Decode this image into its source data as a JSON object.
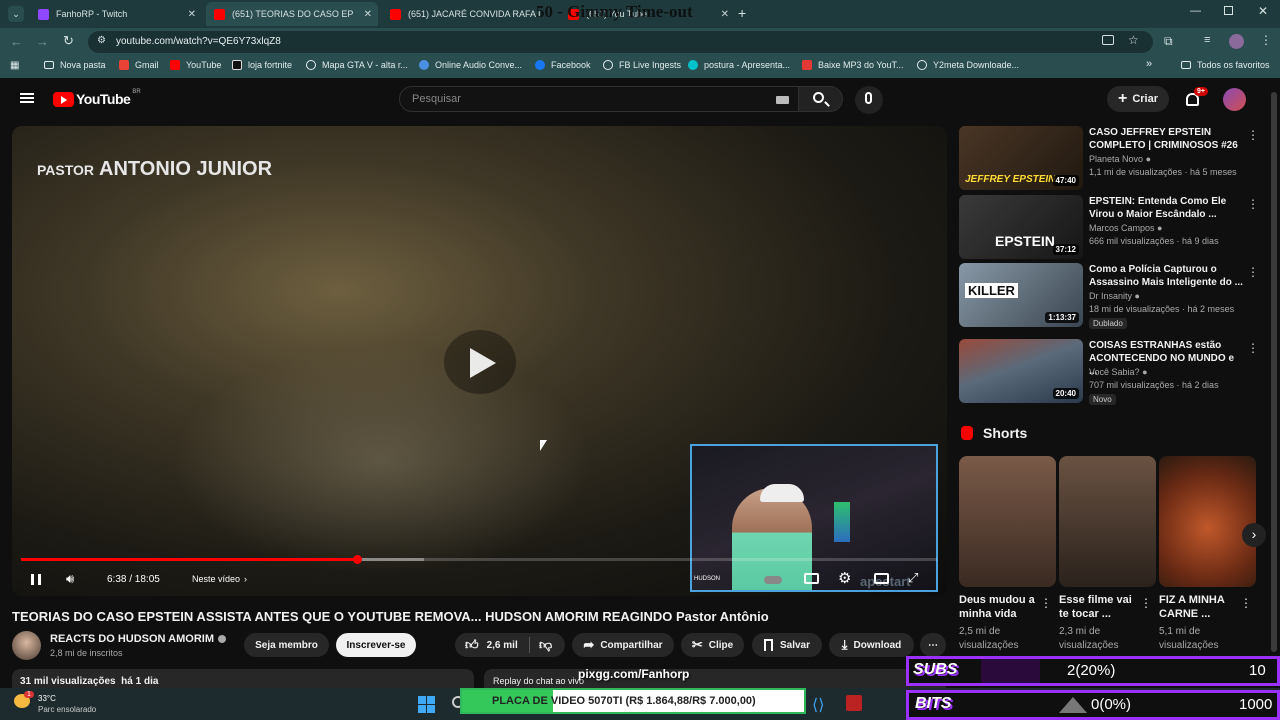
{
  "browser": {
    "tabs": [
      {
        "title": "FanhoRP - Twitch",
        "favicon_color": "#9146ff"
      },
      {
        "title": "(651) TEORIAS DO CASO EP",
        "favicon_color": "#ff0000"
      },
      {
        "title": "(651) JACARÉ CONVIDA RAFA I",
        "favicon_color": "#ff0000"
      },
      {
        "title": "(651) You Tube",
        "favicon_color": "#ff0000"
      }
    ],
    "overlay_text": "50 - Gimmy Time-out",
    "url": "youtube.com/watch?v=QE6Y73xlqZ8",
    "bookmarks": [
      "Nova pasta",
      "Gmail",
      "YouTube",
      "loja fortnite",
      "Mapa GTA V - alta r...",
      "Online Audio Conve...",
      "Facebook",
      "FB Live Ingests",
      "postura - Apresenta...",
      "Baixe MP3 do YouT...",
      "Y2meta Downloade..."
    ],
    "bookmarks_more": "»",
    "all_favorites": "Todos os favoritos"
  },
  "youtube": {
    "logo_text": "YouTube",
    "logo_region": "BR",
    "search_placeholder": "Pesquisar",
    "create_label": "Criar",
    "notif_count": "9+"
  },
  "video": {
    "overlay_title_small": "PASTOR",
    "overlay_title_big": "ANTONIO JUNIOR",
    "time": "6:38 / 18:05",
    "chapter": "Neste vídeo",
    "progress": 0.367,
    "buffered": 0.44,
    "webcam_brand": "HUDSON",
    "webcam_watermark": "apestart",
    "title": "TEORIAS DO CASO EPSTEIN ASSISTA ANTES QUE O YOUTUBE REMOVA... HUDSON AMORIM REAGINDO Pastor Antônio",
    "channel": "REACTS DO HUDSON AMORIM",
    "subscribers": "2,8 mi de inscritos",
    "member_label": "Seja membro",
    "subscribe_label": "Inscrever-se",
    "likes": "2,6 mil",
    "share_label": "Compartilhar",
    "clip_label": "Clipe",
    "save_label": "Salvar",
    "download_label": "Download",
    "views_date": "31 mil visualizações  há 1 dia",
    "chat_replay": "Replay do chat ao vivo"
  },
  "sidebar": {
    "videos": [
      {
        "title": "CASO JEFFREY EPSTEIN COMPLETO | CRIMINOSOS #26",
        "channel": "Planeta Novo",
        "meta": "1,1 mi de visualizações · há 5 meses",
        "duration": "47:40",
        "thumb_text": "JEFFREY EPSTEIN",
        "thumb_bg": "#3a2a1a"
      },
      {
        "title": "EPSTEIN: Entenda Como Ele Virou o Maior Escândalo ...",
        "channel": "Marcos Campos",
        "meta": "666 mil visualizações · há 9 dias",
        "duration": "37:12",
        "thumb_text": "EPSTEIN",
        "thumb_bg": "#2a2a2a"
      },
      {
        "title": "Como a Polícia Capturou o Assassino Mais Inteligente do ...",
        "channel": "Dr Insanity",
        "meta": "18 mi de visualizações · há 2 meses",
        "duration": "1:13:37",
        "thumb_text": "KILLER",
        "thumb_bg": "#5a6a78",
        "badge": "Dublado"
      },
      {
        "title": "COISAS ESTRANHAS estão ACONTECENDO NO MUNDO e ...",
        "channel": "Você Sabia?",
        "meta": "707 mil visualizações · há 2 dias",
        "duration": "20:40",
        "thumb_text": "",
        "thumb_bg": "#4a5a6a",
        "badge": "Novo"
      }
    ],
    "shorts_heading": "Shorts",
    "shorts": [
      {
        "title": "Deus mudou a minha vida",
        "views": "2,5 mi de visualizações",
        "bg": "#6a5040"
      },
      {
        "title": "Esse filme vai te tocar ...",
        "views": "2,3 mi de visualizações",
        "bg": "#5a4a3a"
      },
      {
        "title": "FIZ A MINHA CARNE ...",
        "views": "5,1 mi de visualizações",
        "bg": "#7a3a20"
      }
    ]
  },
  "stream_overlay": {
    "pix_url": "pixgg.com/Fanhorp",
    "goal_label": "PLACA DE VIDEO 5070TI (R$ 1.864,88/R$ 7.000,00)",
    "goal_progress": 0.266,
    "subs_label": "SUBS",
    "subs_value": "2(20%)",
    "subs_target": "10",
    "bits_label": "BITS",
    "bits_value": "0(0%)",
    "bits_target": "1000"
  },
  "taskbar": {
    "temperature": "33°C",
    "weather": "Parc ensolarado",
    "notification": "1"
  }
}
